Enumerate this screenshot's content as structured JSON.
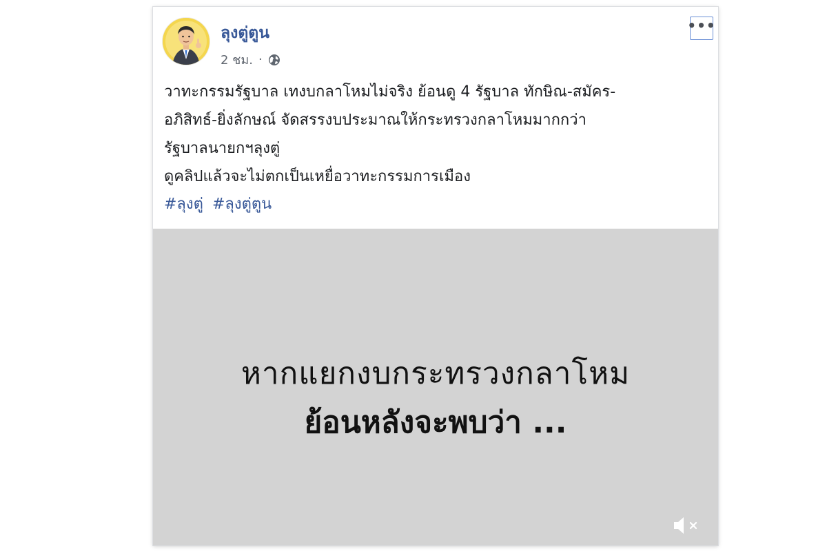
{
  "post": {
    "author": "ลุงตู่ตูน",
    "time": "2 ชม.",
    "separator": "·",
    "privacy_icon": "globe-icon",
    "more_label": "•••",
    "text_lines": [
      "วาทะกรรมรัฐบาล เทงบกลาโหมไม่จริง ย้อนดู 4 รัฐบาล ทักษิณ-สมัคร-",
      "อภิสิทธ์-ยิ่งลักษณ์ จัดสรรงบประมาณให้กระทรวงกลาโหมมากกว่า",
      "รัฐบาลนายกฯลุงตู่",
      "ดูคลิปแล้วจะไม่ตกเป็นเหยื่อวาทะกรรมการเมือง"
    ],
    "hashtags": [
      "#ลุงตู่",
      "#ลุงตู่ตูน"
    ]
  },
  "video": {
    "line1": "หากแยกงบกระทรวงกลาโหม",
    "line2": "ย้อนหลังจะพบว่า ...",
    "mute_icon": "speaker-muted-icon",
    "background_color": "#d3d3d3"
  },
  "colors": {
    "link": "#385898",
    "text": "#1c1e21",
    "meta": "#616770"
  }
}
